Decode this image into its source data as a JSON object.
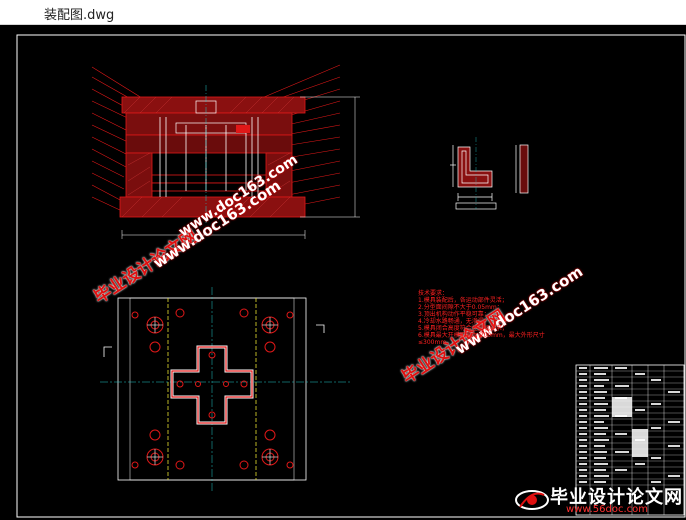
{
  "window": {
    "title": "装配图.dwg"
  },
  "watermarks": {
    "site_cn": "毕业设计论文网",
    "site_url": "www.doc163.com"
  },
  "tech_notes": [
    "技术要求：",
    "1.模具装配后，各运动部件灵活；",
    "2.分型面间隙不大于0.05mm；",
    "3.顶出机构动作平稳可靠；",
    "4.冷却水路畅通，无渗漏；",
    "5.模具闭合高度符合注塑机要求；",
    "6.模具最大开模距离为 200mm，最大外形尺寸",
    "  ≤300mm"
  ],
  "footer_logo": {
    "brand": "毕业设计论文网",
    "url": "www.56doc.com"
  },
  "colors": {
    "background": "#000000",
    "red": "#e01818",
    "white": "#ffffff",
    "yellow": "#e8e030",
    "cyan": "#20c8c8",
    "green": "#20c020"
  }
}
